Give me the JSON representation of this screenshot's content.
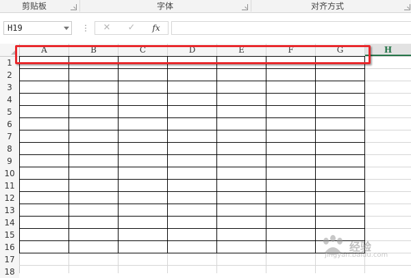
{
  "ribbon": {
    "groups": [
      {
        "label": "剪贴板"
      },
      {
        "label": "字体"
      },
      {
        "label": "对齐方式"
      }
    ]
  },
  "formula_bar": {
    "name_box": "H19",
    "cancel_glyph": "✕",
    "enter_glyph": "✓",
    "fx_label": "fx",
    "formula_value": ""
  },
  "sheet": {
    "columns": [
      "A",
      "B",
      "C",
      "D",
      "E",
      "F",
      "G",
      "H"
    ],
    "selected_column": "H",
    "rows": [
      "1",
      "2",
      "3",
      "4",
      "5",
      "6",
      "7",
      "8",
      "9",
      "10",
      "11",
      "12",
      "13",
      "14",
      "15",
      "16",
      "17",
      "18"
    ],
    "bordered_rows": 16,
    "bordered_cols": 7
  },
  "annotation": {
    "highlight_color": "#e8262a"
  },
  "watermark": {
    "main": "经验",
    "sub": "jingyan.baidu.com"
  },
  "colors": {
    "accent": "#217346",
    "gridline": "#d4d4d4",
    "border": "#000000"
  }
}
